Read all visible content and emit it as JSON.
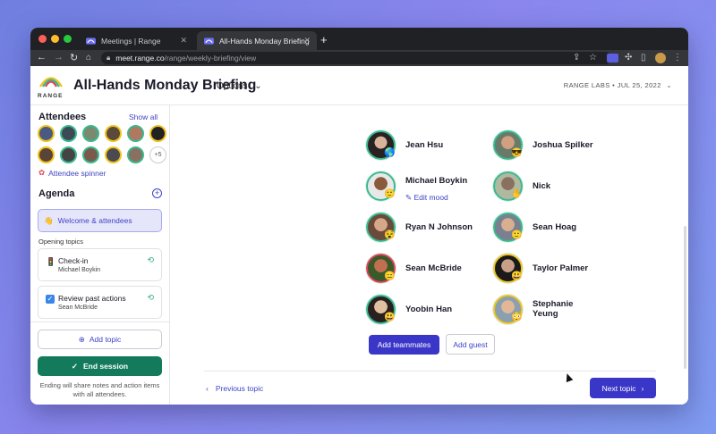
{
  "browser": {
    "tabs": [
      {
        "title": "Meetings | Range"
      },
      {
        "title": "All-Hands Monday Briefing | Ran"
      }
    ],
    "url_host": "meet.range.co",
    "url_path": "/range/weekly-briefing/view"
  },
  "header": {
    "logo_text": "RANGE",
    "title": "All-Hands Monday Briefing",
    "options_label": "Options",
    "org_date": "RANGE LABS • JUL 25, 2022"
  },
  "sidebar": {
    "attendees_heading": "Attendees",
    "show_all": "Show all",
    "more_count": "+5",
    "spinner_label": "Attendee spinner",
    "agenda_heading": "Agenda",
    "welcome_item": "Welcome & attendees",
    "section_label": "Opening topics",
    "topics": [
      {
        "title": "Check-in",
        "owner": "Michael Boykin"
      },
      {
        "title": "Review past actions",
        "owner": "Sean McBride"
      }
    ],
    "add_topic": "Add topic",
    "end_session": "End session",
    "end_note": "Ending will share notes and action items with all attendees."
  },
  "main": {
    "people_left": [
      {
        "name": "Jean Hsu"
      },
      {
        "name": "Michael Boykin"
      },
      {
        "name": "Ryan N Johnson"
      },
      {
        "name": "Sean McBride"
      },
      {
        "name": "Yoobin Han"
      }
    ],
    "people_right": [
      {
        "name": "Joshua Spilker"
      },
      {
        "name": "Nick"
      },
      {
        "name": "Sean Hoag"
      },
      {
        "name": "Taylor Palmer"
      },
      {
        "name_line1": "Stephanie",
        "name_line2": "Yeung"
      }
    ],
    "edit_mood": "Edit mood",
    "add_teammates": "Add teammates",
    "add_guest": "Add guest",
    "previous_topic": "Previous topic",
    "next_topic": "Next topic"
  },
  "colors": {
    "accent": "#3a36c8",
    "end_session": "#147a5c",
    "attendee_ring": "#38b98d"
  }
}
